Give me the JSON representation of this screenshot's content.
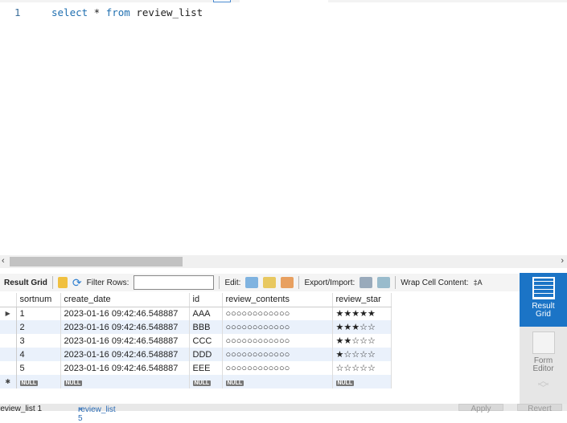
{
  "editor": {
    "line_number": "1",
    "kw1": "select",
    "rest1": " * ",
    "kw2": "from",
    "rest2": " review_list"
  },
  "toolbar": {
    "result_grid": "Result Grid",
    "filter_rows": "Filter Rows:",
    "filter_value": "",
    "edit": "Edit:",
    "export_import": "Export/Import:",
    "wrap": "Wrap Cell Content:"
  },
  "grid": {
    "columns": [
      "sortnum",
      "create_date",
      "id",
      "review_contents",
      "review_star"
    ],
    "rows": [
      [
        "1",
        "2023-01-16 09:42:46.548887",
        "AAA",
        "○○○○○○○○○○○○",
        "★★★★★"
      ],
      [
        "2",
        "2023-01-16 09:42:46.548887",
        "BBB",
        "○○○○○○○○○○○○",
        "★★★☆☆"
      ],
      [
        "3",
        "2023-01-16 09:42:46.548887",
        "CCC",
        "○○○○○○○○○○○○",
        "★★☆☆☆"
      ],
      [
        "4",
        "2023-01-16 09:42:46.548887",
        "DDD",
        "○○○○○○○○○○○○",
        "★☆☆☆☆"
      ],
      [
        "5",
        "2023-01-16 09:42:46.548887",
        "EEE",
        "○○○○○○○○○○○○",
        "☆☆☆☆☆"
      ]
    ],
    "null_label": "NULL"
  },
  "side": {
    "result_grid_1": "Result",
    "result_grid_2": "Grid",
    "form_editor_1": "Form",
    "form_editor_2": "Editor"
  },
  "bottom": {
    "tab1": "review_list 1",
    "tab2": "review_list 5",
    "close": "×",
    "apply": "Apply",
    "revert": "Revert"
  }
}
